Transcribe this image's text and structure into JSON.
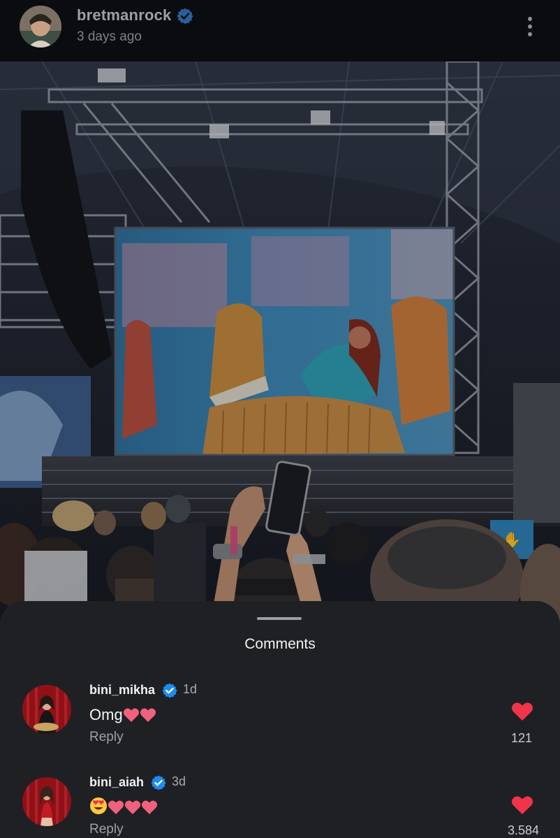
{
  "post": {
    "username": "bretmanrock",
    "time": "3 days ago",
    "verified": true,
    "icons": {
      "avatar": "avatar-photo",
      "menu": "more-vertical-icon",
      "verified": "verified-badge-icon"
    }
  },
  "photo": {
    "description_icon": "concert-photo"
  },
  "comments_sheet": {
    "title": "Comments",
    "items": [
      {
        "username": "bini_mikha",
        "verified": true,
        "time": "1d",
        "text": "Omg",
        "emoji": [
          "pink-heart",
          "pink-heart"
        ],
        "reply_label": "Reply",
        "likes": "121"
      },
      {
        "username": "bini_aiah",
        "verified": true,
        "time": "3d",
        "text": "",
        "emoji": [
          "heart-eyes",
          "pink-heart",
          "pink-heart",
          "pink-heart"
        ],
        "reply_label": "Reply",
        "likes": "3.584"
      }
    ]
  },
  "colors": {
    "background": "#0b0c0f",
    "sheet": "#1f2024",
    "verified": "#1d8cf0",
    "like": "#f0344a",
    "pink_heart": "#f2607f"
  }
}
